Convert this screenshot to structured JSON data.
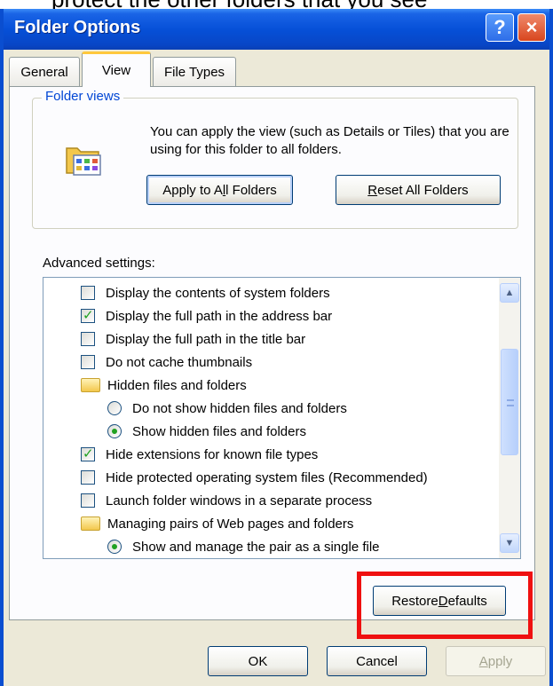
{
  "window": {
    "title": "Folder Options",
    "help_icon": "?",
    "close_icon": "×"
  },
  "tabs": [
    {
      "label": "General"
    },
    {
      "label": "View"
    },
    {
      "label": "File Types"
    }
  ],
  "folder_views": {
    "legend": "Folder views",
    "description": "You can apply the view (such as Details or Tiles) that you are using for this folder to all folders.",
    "apply_button": {
      "pre": "Apply to A",
      "acc": "l",
      "post": "l Folders"
    },
    "reset_button": {
      "pre": "",
      "acc": "R",
      "post": "eset All Folders"
    }
  },
  "advanced": {
    "label": "Advanced settings:",
    "items": [
      {
        "type": "checkbox",
        "checked": false,
        "label": "Display the contents of system folders"
      },
      {
        "type": "checkbox",
        "checked": true,
        "label": "Display the full path in the address bar"
      },
      {
        "type": "checkbox",
        "checked": false,
        "label": "Display the full path in the title bar"
      },
      {
        "type": "checkbox",
        "checked": false,
        "label": "Do not cache thumbnails"
      },
      {
        "type": "folder",
        "label": "Hidden files and folders"
      },
      {
        "type": "radio",
        "checked": false,
        "label": "Do not show hidden files and folders"
      },
      {
        "type": "radio",
        "checked": true,
        "label": "Show hidden files and folders"
      },
      {
        "type": "checkbox",
        "checked": true,
        "label": "Hide extensions for known file types"
      },
      {
        "type": "checkbox",
        "checked": false,
        "label": "Hide protected operating system files (Recommended)"
      },
      {
        "type": "checkbox",
        "checked": false,
        "label": "Launch folder windows in a separate process"
      },
      {
        "type": "folder",
        "label": "Managing pairs of Web pages and folders"
      },
      {
        "type": "radio",
        "checked": true,
        "label": "Show and manage the pair as a single file"
      }
    ]
  },
  "buttons": {
    "restore": {
      "pre": "Restore ",
      "acc": "D",
      "post": "efaults"
    },
    "ok": "OK",
    "cancel": "Cancel",
    "apply": {
      "pre": "",
      "acc": "A",
      "post": "pply"
    }
  },
  "colors": {
    "titlebar": "#0650d8",
    "highlight": "#ef1010",
    "legend": "#0046d5"
  }
}
